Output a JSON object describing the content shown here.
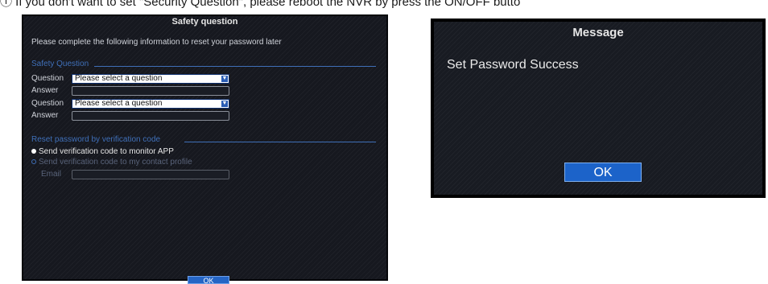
{
  "top_note": {
    "text": "ⓘ If you don't want to set \"Security Question\", please reboot the NVR by press the ON/OFF butto"
  },
  "safety_dialog": {
    "title": "Safety question",
    "intro": "Please complete the following information to reset your password later",
    "safety_section_label": "Safety Question",
    "question1_label": "Question",
    "question1_value": "Please select a question",
    "answer1_label": "Answer",
    "answer1_value": "",
    "question2_label": "Question",
    "question2_value": "Please select a question",
    "answer2_label": "Answer",
    "answer2_value": "",
    "reset_section_label": "Reset password by verification code",
    "radio1_label": "Send verification code to monitor APP",
    "radio2_label": "Send verification code to my contact profile",
    "email_label": "Email",
    "email_value": "",
    "ok_label": "OK",
    "colors": {
      "background": "#16181f",
      "accent": "#3f6fb8",
      "button": "#2565c5"
    }
  },
  "message_dialog": {
    "title": "Message",
    "message": "Set Password Success",
    "ok_label": "OK",
    "colors": {
      "background": "#181b22",
      "button": "#1c63c9"
    }
  }
}
